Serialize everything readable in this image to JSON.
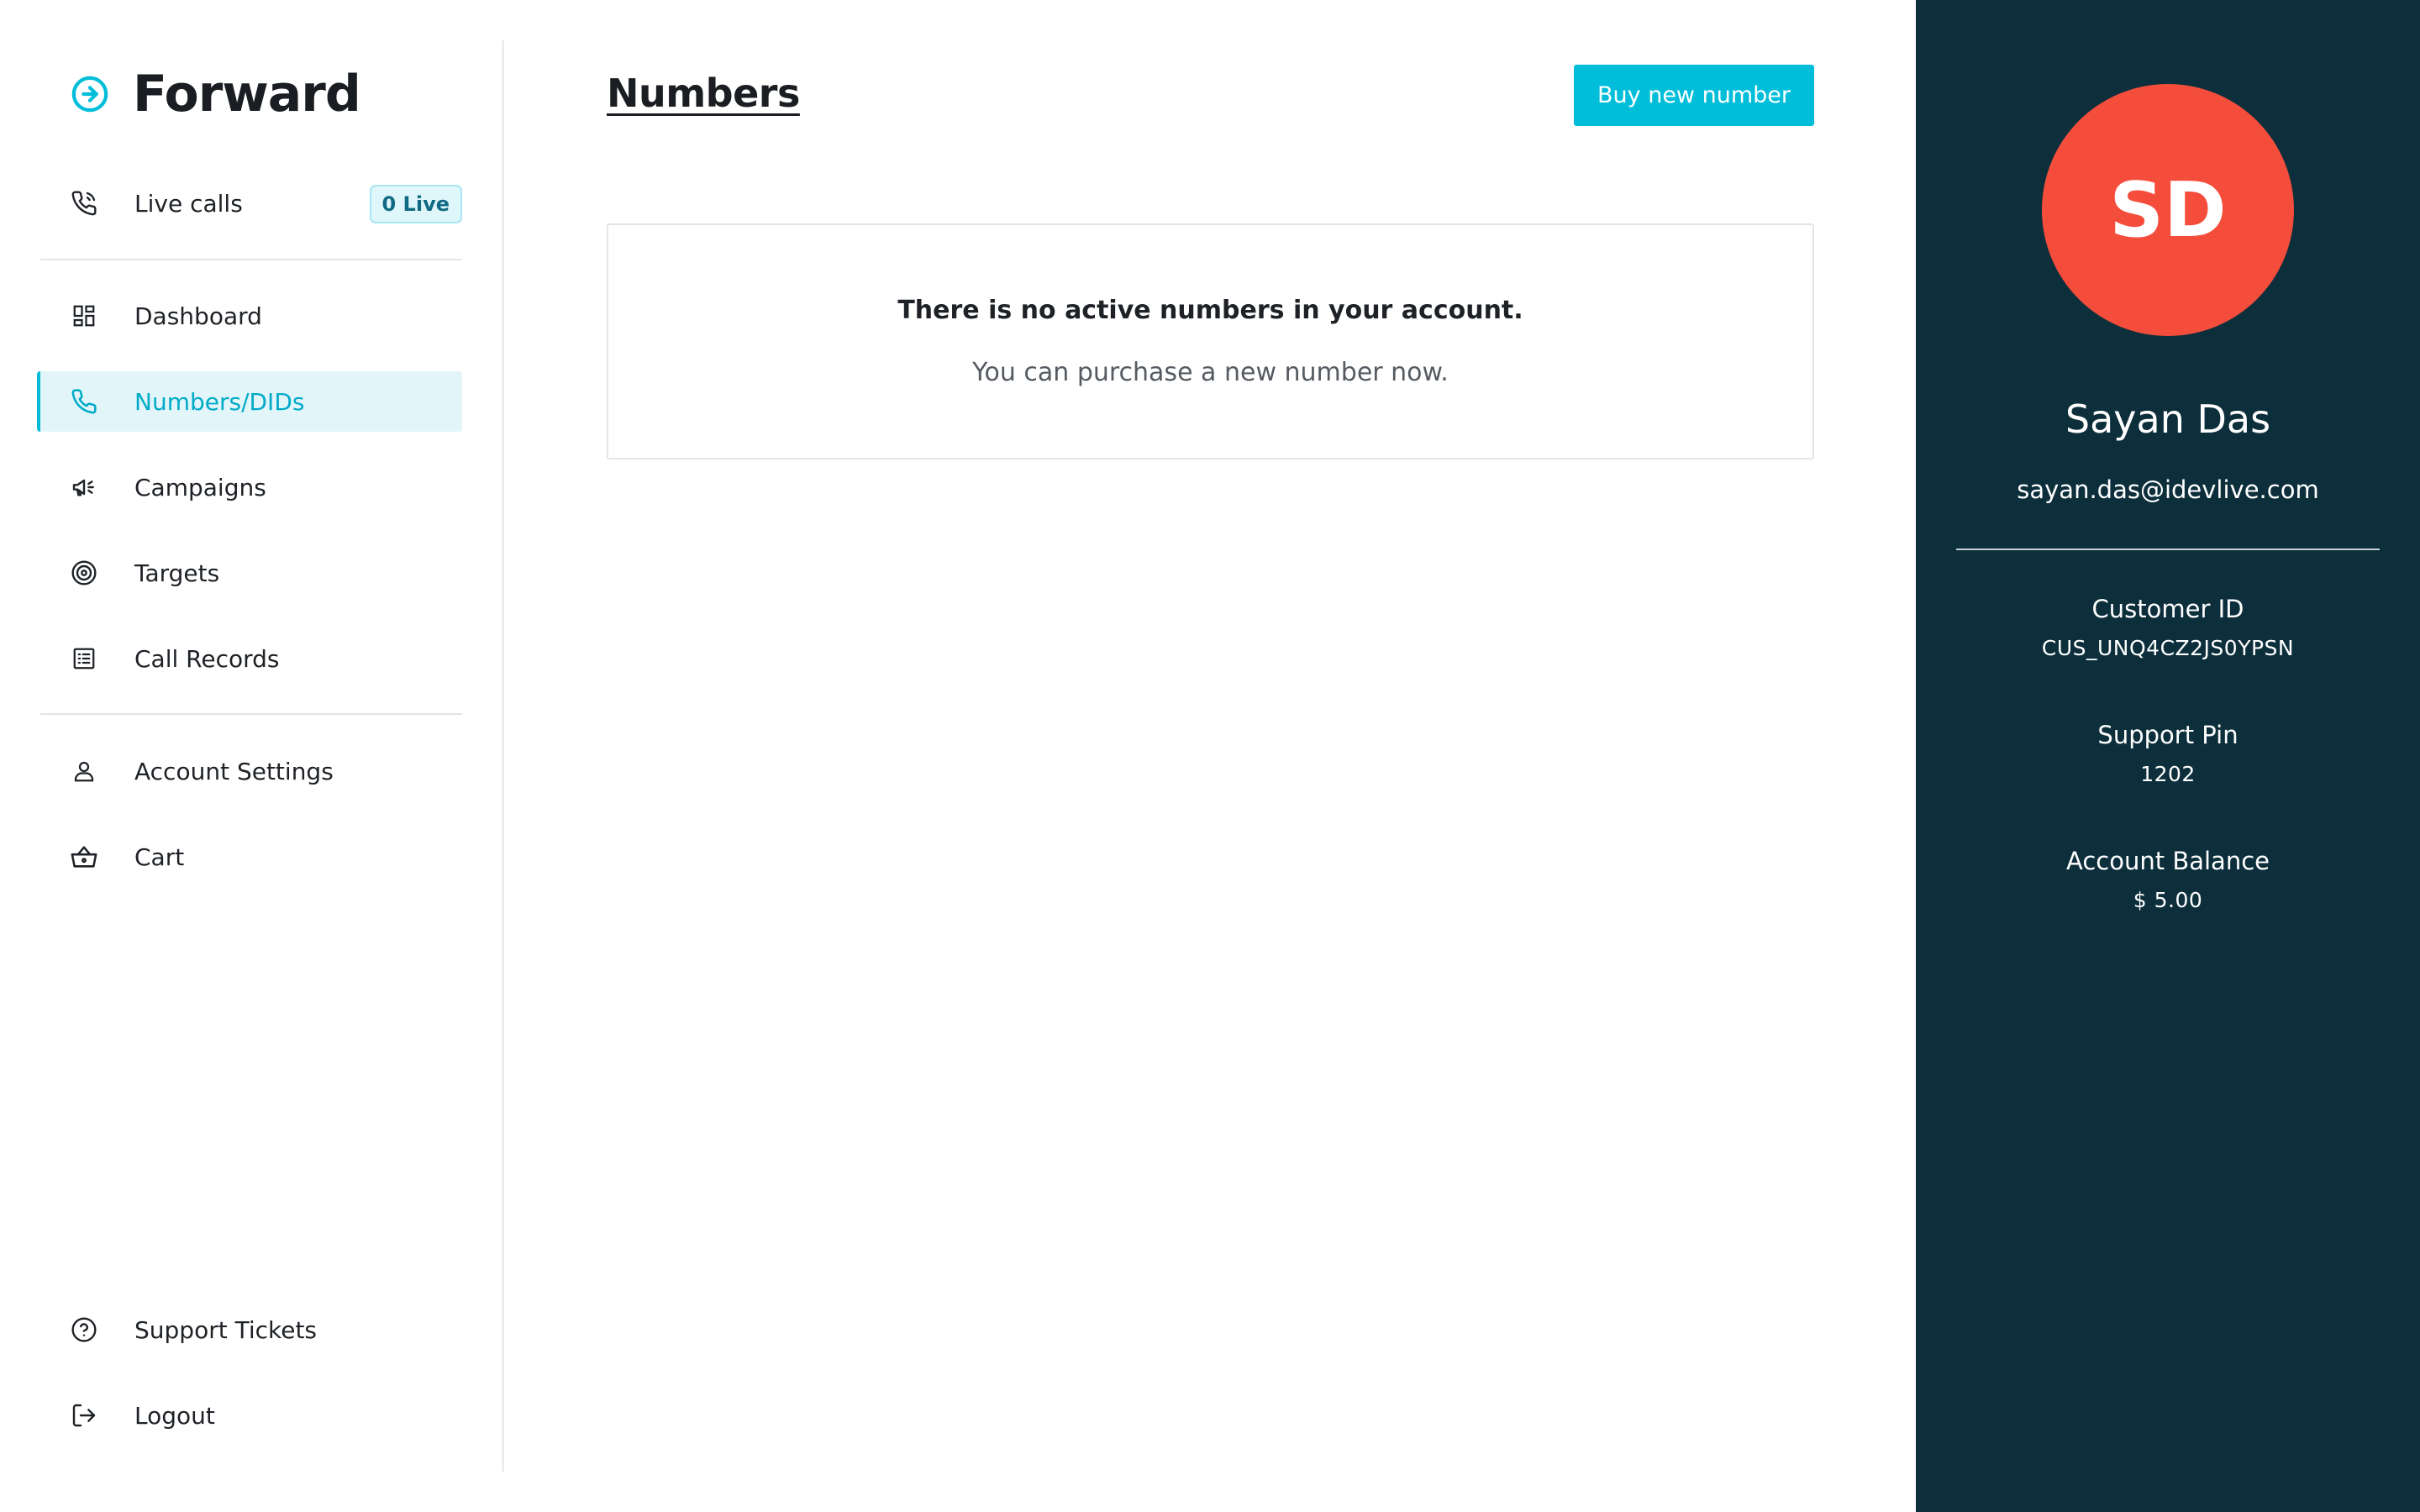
{
  "brand": {
    "name": "Forward",
    "accent_color": "#00bed9"
  },
  "sidebar": {
    "live_calls": {
      "label": "Live calls",
      "badge": "0 Live",
      "icon": "phone-call-icon"
    },
    "items": [
      {
        "label": "Dashboard",
        "icon": "dashboard-icon"
      },
      {
        "label": "Numbers/DIDs",
        "icon": "phone-icon",
        "active": true
      },
      {
        "label": "Campaigns",
        "icon": "megaphone-icon"
      },
      {
        "label": "Targets",
        "icon": "target-icon"
      },
      {
        "label": "Call Records",
        "icon": "list-icon"
      }
    ],
    "account_items": [
      {
        "label": "Account Settings",
        "icon": "user-icon"
      },
      {
        "label": "Cart",
        "icon": "basket-icon"
      }
    ],
    "bottom_items": [
      {
        "label": "Support Tickets",
        "icon": "help-circle-icon"
      },
      {
        "label": "Logout",
        "icon": "logout-icon"
      }
    ]
  },
  "main": {
    "title": "Numbers",
    "buy_button_label": "Buy new number",
    "empty_state": {
      "headline": "There is no active numbers in your account.",
      "subtext": "You can purchase a new number now."
    }
  },
  "profile": {
    "initials": "SD",
    "avatar_color": "#f54d3b",
    "background_color": "#0d2f3c",
    "name": "Sayan Das",
    "email": "sayan.das@idevlive.com",
    "customer_id_label": "Customer ID",
    "customer_id": "CUS_UNQ4CZ2JS0YPSN",
    "support_pin_label": "Support Pin",
    "support_pin": "1202",
    "account_balance_label": "Account Balance",
    "account_balance": "$ 5.00"
  }
}
